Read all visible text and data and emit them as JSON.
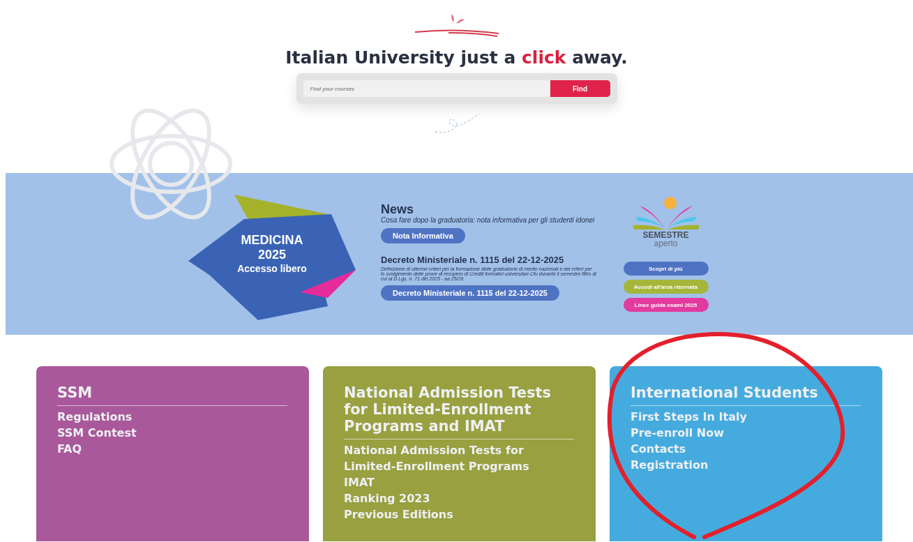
{
  "hero": {
    "headline": {
      "before": "Italian University just a ",
      "highlight": "click",
      "after": " away."
    },
    "search": {
      "placeholder": "Find your courses",
      "button": "Find"
    }
  },
  "banner": {
    "badge": {
      "title": "MEDICINA",
      "year": "2025",
      "subtitle": "Accesso libero"
    },
    "news": {
      "heading": "News",
      "items": [
        {
          "kind": "note",
          "text": "Cosa fare dopo la graduatoria: nota informativa per gli studenti idonei",
          "button": "Nota Informativa"
        },
        {
          "kind": "decree",
          "title": "Decreto Ministeriale n. 1115 del 22-12-2025",
          "text": "Definizione di ulteriori criteri per la formazione delle graduatorie di merito nazionali e dei criteri per lo svolgimento delle prove di recupero di Crediti formativi universitari-Cfu durante il semestre filtro di cui al D.Lgs. n. 71 del 2025 - aa 25/26",
          "button": "Decreto Ministeriale n. 1115 del 22-12-2025"
        }
      ]
    },
    "semestre": {
      "logo_title": "SEMESTRE",
      "logo_subtitle": "aperto",
      "buttons": [
        {
          "label": "Scopri di più",
          "color": "#4f73c3"
        },
        {
          "label": "Accedi all'area riservata",
          "color": "#a5b63a"
        },
        {
          "label": "Linee guida esami 2025",
          "color": "#e23a9f"
        }
      ]
    }
  },
  "cards": [
    {
      "title": "SSM",
      "color": "#a9589b",
      "links": [
        "Regulations",
        "SSM Contest",
        "FAQ"
      ]
    },
    {
      "title": "National Admission Tests for Limited-Enrollment Programs and IMAT",
      "color": "#98a040",
      "links": [
        "National Admission Tests for Limited-Enrollment Programs",
        "IMAT",
        "Ranking 2023",
        "Previous Editions"
      ]
    },
    {
      "title": "International Students",
      "color": "#45abdf",
      "links": [
        "First Steps In Italy",
        "Pre-enroll Now",
        "Contacts",
        "Registration"
      ]
    }
  ]
}
